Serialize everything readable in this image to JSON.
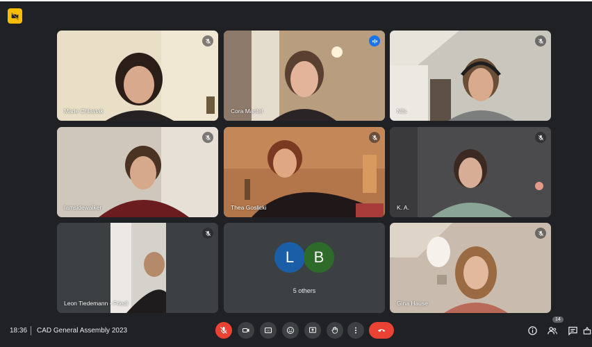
{
  "participants": [
    {
      "name": "Marie Chlastak",
      "muted": true
    },
    {
      "name": "Cora Mantel",
      "muted": false,
      "speaking": true
    },
    {
      "name": "Nils",
      "muted": true
    },
    {
      "name": "Iamsidewalker",
      "muted": true
    },
    {
      "name": "Thea Goslicki",
      "muted": true
    },
    {
      "name": "K. A.",
      "muted": true
    },
    {
      "name": "Leon Tiedemann - Friedl",
      "muted": true
    },
    {
      "name": "Gina Hause",
      "muted": true
    }
  ],
  "others": {
    "avatars": [
      "L",
      "B"
    ],
    "label": "5 others"
  },
  "bottom": {
    "time": "18:36",
    "meeting_title": "CAD General Assembly 2023",
    "people_count": "14"
  },
  "colors": {
    "accent": "#8ab4f8",
    "hangup": "#ea4335",
    "badge": "#fbbc04",
    "avatar_l": "#1a5ea8",
    "avatar_b": "#2e6b2a"
  },
  "icons": [
    "camera-off-icon",
    "mic-off-icon",
    "audio-wave-icon",
    "mic-icon",
    "camera-icon",
    "captions-icon",
    "emoji-icon",
    "present-icon",
    "raise-hand-icon",
    "more-icon",
    "hangup-icon",
    "info-icon",
    "people-icon",
    "chat-icon",
    "activities-icon"
  ]
}
